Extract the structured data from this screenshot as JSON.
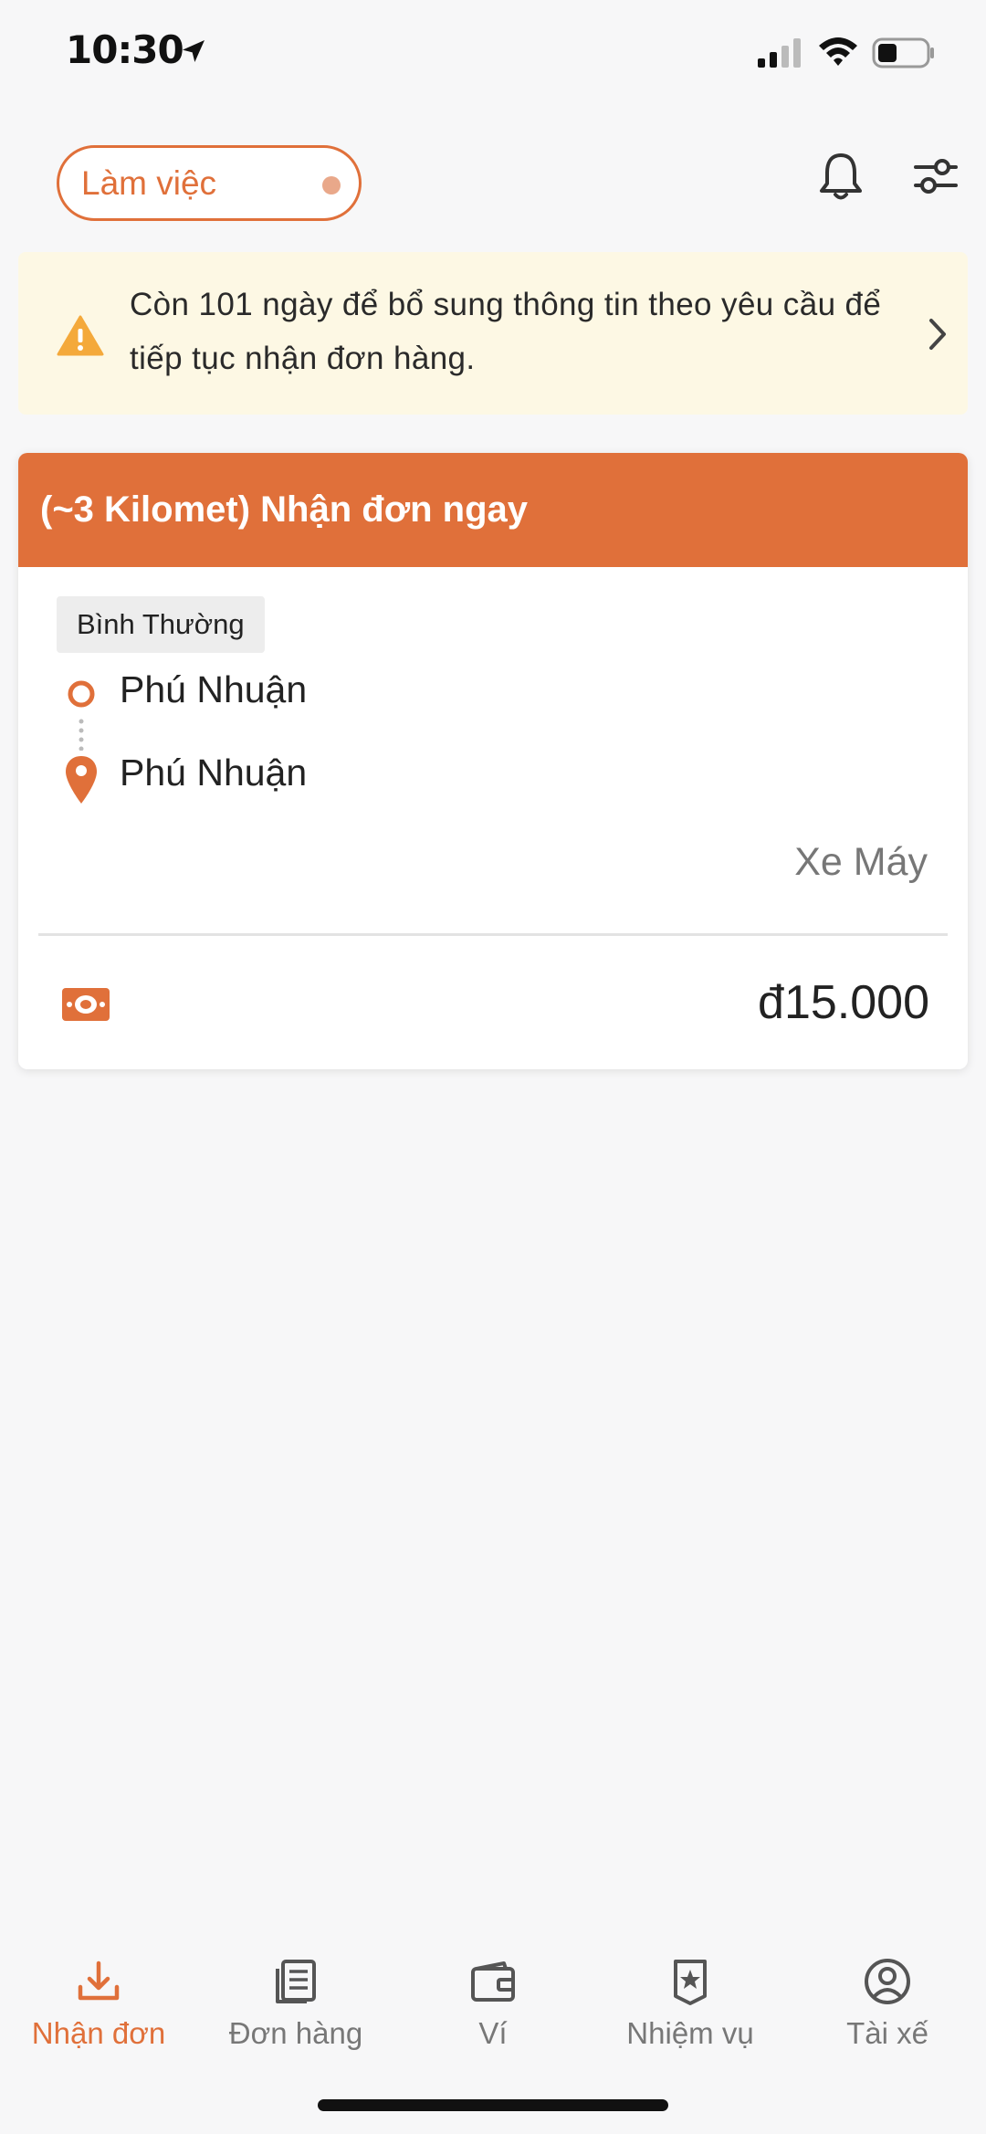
{
  "status_bar": {
    "time": "10:30"
  },
  "top_bar": {
    "work_toggle_label": "Làm việc"
  },
  "notice": {
    "text": "Còn 101 ngày để bổ sung thông tin theo yêu cầu để tiếp tục nhận đơn hàng."
  },
  "order": {
    "header_title": "(~3 Kilomet) Nhận đơn ngay",
    "tag": "Bình Thường",
    "pickup": "Phú Nhuận",
    "dropoff": "Phú Nhuận",
    "vehicle": "Xe Máy",
    "price": "đ15.000"
  },
  "nav": {
    "items": [
      {
        "label": "Nhận đơn",
        "icon": "download-icon",
        "active": true
      },
      {
        "label": "Đơn hàng",
        "icon": "document-icon",
        "active": false
      },
      {
        "label": "Ví",
        "icon": "wallet-icon",
        "active": false
      },
      {
        "label": "Nhiệm vụ",
        "icon": "badge-star-icon",
        "active": false
      },
      {
        "label": "Tài xế",
        "icon": "user-circle-icon",
        "active": false
      }
    ]
  },
  "colors": {
    "accent": "#e0703a",
    "notice_bg": "#fdf8e4",
    "warning": "#f4a93b"
  }
}
